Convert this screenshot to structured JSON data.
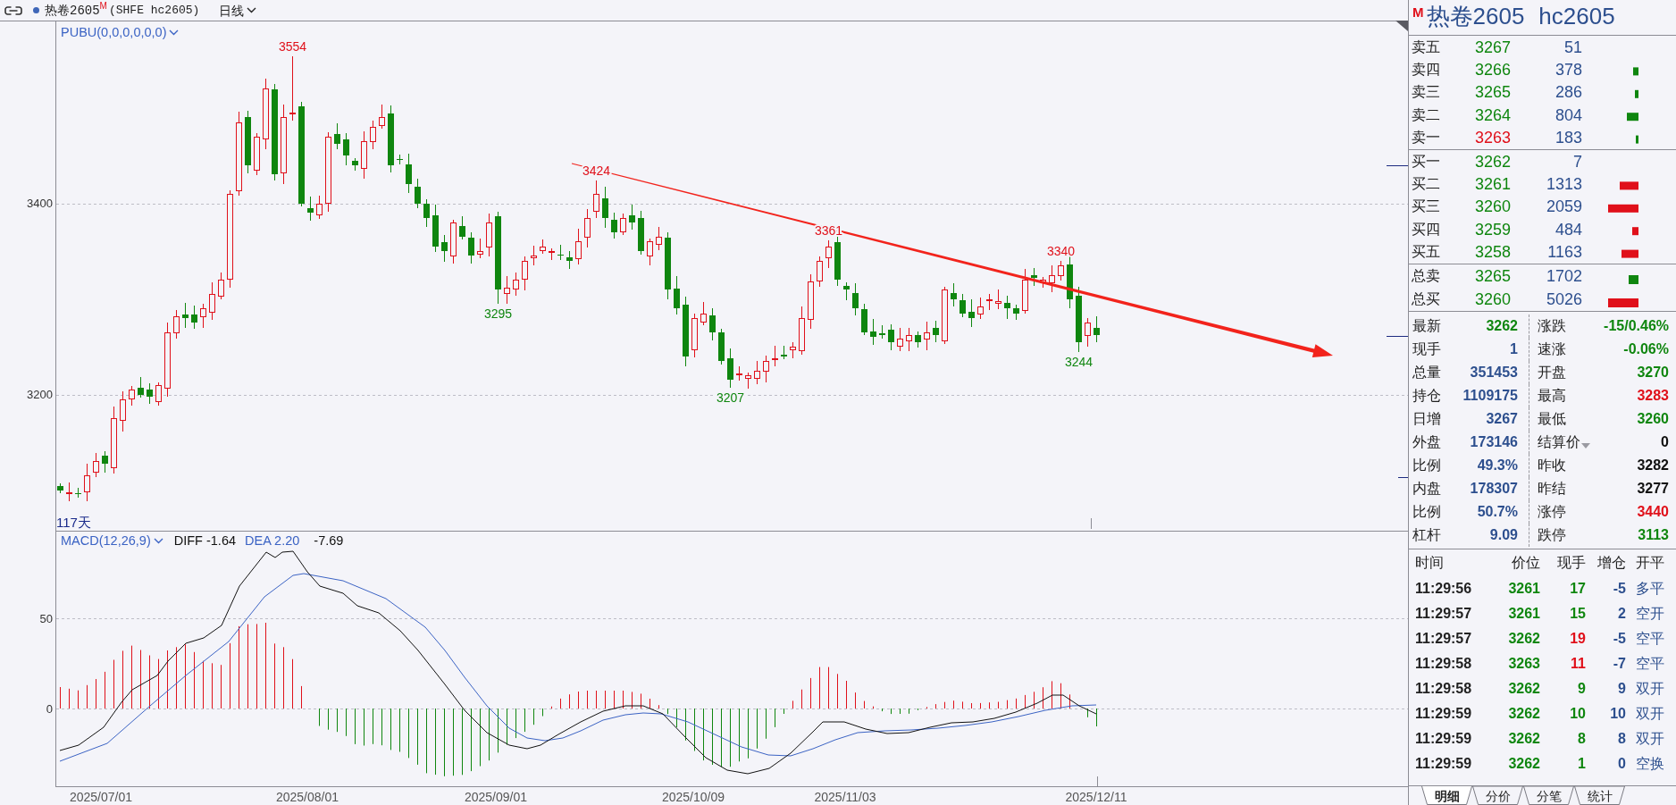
{
  "header": {
    "symbol": "热卷2605",
    "flag": "M",
    "code": "(SHFE hc2605)",
    "period": "日线"
  },
  "price_chart": {
    "indicator": "PUBU(0,0,0,0,0,0)",
    "yticks": [
      "3400",
      "3200"
    ],
    "annotations": [
      {
        "text": "3554",
        "kind": "high"
      },
      {
        "text": "3295",
        "kind": "low"
      },
      {
        "text": "3424",
        "kind": "high"
      },
      {
        "text": "3207",
        "kind": "low"
      },
      {
        "text": "3361",
        "kind": "high"
      },
      {
        "text": "3340",
        "kind": "high"
      },
      {
        "text": "3244",
        "kind": "low"
      }
    ],
    "bar_count": "117天"
  },
  "macd_chart": {
    "indicator": "MACD(12,26,9)",
    "readouts": [
      {
        "text": "DIFF -1.64",
        "color": "#111111"
      },
      {
        "text": "DEA 2.20",
        "color": "#3b63c4"
      },
      {
        "text": "-7.69",
        "color": "#111111"
      }
    ],
    "yticks": [
      "50",
      "0"
    ]
  },
  "x_axis": {
    "labels": [
      "2025/07/01",
      "2025/08/01",
      "2025/09/01",
      "2025/10/09",
      "2025/11/03",
      "2025/12/11"
    ]
  },
  "quote_panel": {
    "flag": "M",
    "name": "热卷2605",
    "code": "hc2605",
    "asks": [
      {
        "label": "卖五",
        "price": "3267",
        "volume": "51",
        "color": "#0f860f"
      },
      {
        "label": "卖四",
        "price": "3266",
        "volume": "378",
        "color": "#0f860f"
      },
      {
        "label": "卖三",
        "price": "3265",
        "volume": "286",
        "color": "#0f860f"
      },
      {
        "label": "卖二",
        "price": "3264",
        "volume": "804",
        "color": "#0f860f"
      },
      {
        "label": "卖一",
        "price": "3263",
        "volume": "183",
        "color": "#e0101a"
      }
    ],
    "bids": [
      {
        "label": "买一",
        "price": "3262",
        "volume": "7",
        "color": "#0f860f"
      },
      {
        "label": "买二",
        "price": "3261",
        "volume": "1313",
        "color": "#0f860f"
      },
      {
        "label": "买三",
        "price": "3260",
        "volume": "2059",
        "color": "#0f860f"
      },
      {
        "label": "买四",
        "price": "3259",
        "volume": "484",
        "color": "#0f860f"
      },
      {
        "label": "买五",
        "price": "3258",
        "volume": "1163",
        "color": "#0f860f"
      }
    ],
    "totals": [
      {
        "label": "总卖",
        "price": "3265",
        "volume": "1702"
      },
      {
        "label": "总买",
        "price": "3260",
        "volume": "5026"
      }
    ],
    "stats": [
      {
        "label": "最新",
        "value": "3262",
        "color": "#0f860f",
        "dropdown": false
      },
      {
        "label": "涨跌",
        "value": "-15/0.46%",
        "color": "#0f860f",
        "dropdown": false
      },
      {
        "label": "现手",
        "value": "1",
        "color": "#2d4f8e",
        "dropdown": false
      },
      {
        "label": "速涨",
        "value": "-0.06%",
        "color": "#0f860f",
        "dropdown": false
      },
      {
        "label": "总量",
        "value": "351453",
        "color": "#2d4f8e",
        "dropdown": false
      },
      {
        "label": "开盘",
        "value": "3270",
        "color": "#0f860f",
        "dropdown": false
      },
      {
        "label": "持仓",
        "value": "1109175",
        "color": "#2d4f8e",
        "dropdown": false
      },
      {
        "label": "最高",
        "value": "3283",
        "color": "#e0101a",
        "dropdown": false
      },
      {
        "label": "日增",
        "value": "3267",
        "color": "#2d4f8e",
        "dropdown": false
      },
      {
        "label": "最低",
        "value": "3260",
        "color": "#0f860f",
        "dropdown": false
      },
      {
        "label": "外盘",
        "value": "173146",
        "color": "#2d4f8e",
        "dropdown": false
      },
      {
        "label": "结算价",
        "value": "0",
        "color": "#111111",
        "dropdown": true
      },
      {
        "label": "比例",
        "value": "49.3%",
        "color": "#2d4f8e",
        "dropdown": false
      },
      {
        "label": "昨收",
        "value": "3282",
        "color": "#111111",
        "dropdown": false
      },
      {
        "label": "内盘",
        "value": "178307",
        "color": "#2d4f8e",
        "dropdown": false
      },
      {
        "label": "昨结",
        "value": "3277",
        "color": "#111111",
        "dropdown": false
      },
      {
        "label": "比例",
        "value": "50.7%",
        "color": "#2d4f8e",
        "dropdown": false
      },
      {
        "label": "涨停",
        "value": "3440",
        "color": "#e0101a",
        "dropdown": false
      },
      {
        "label": "杠杆",
        "value": "9.09",
        "color": "#2d4f8e",
        "dropdown": false
      },
      {
        "label": "跌停",
        "value": "3113",
        "color": "#0f860f",
        "dropdown": false
      }
    ],
    "trades": {
      "columns": [
        "时间",
        "价位",
        "现手",
        "增仓",
        "开平"
      ],
      "rows": [
        {
          "time": "11:29:56",
          "price": "3261",
          "volume": "17",
          "color": "#0f860f",
          "oi_change": "-5",
          "type": "多平"
        },
        {
          "time": "11:29:57",
          "price": "3261",
          "volume": "15",
          "color": "#0f860f",
          "oi_change": "2",
          "type": "空开"
        },
        {
          "time": "11:29:57",
          "price": "3262",
          "volume": "19",
          "color": "#e0101a",
          "oi_change": "-5",
          "type": "空平"
        },
        {
          "time": "11:29:58",
          "price": "3263",
          "volume": "11",
          "color": "#e0101a",
          "oi_change": "-7",
          "type": "空平"
        },
        {
          "time": "11:29:58",
          "price": "3262",
          "volume": "9",
          "color": "#0f860f",
          "oi_change": "9",
          "type": "双开"
        },
        {
          "time": "11:29:59",
          "price": "3262",
          "volume": "10",
          "color": "#0f860f",
          "oi_change": "10",
          "type": "双开"
        },
        {
          "time": "11:29:59",
          "price": "3262",
          "volume": "8",
          "color": "#0f860f",
          "oi_change": "8",
          "type": "双开"
        },
        {
          "time": "11:29:59",
          "price": "3262",
          "volume": "1",
          "color": "#0f860f",
          "oi_change": "0",
          "type": "空换"
        }
      ]
    },
    "tabs": [
      {
        "label": "明细",
        "selected": true
      },
      {
        "label": "分价",
        "selected": false
      },
      {
        "label": "分笔",
        "selected": false
      },
      {
        "label": "统计",
        "selected": false
      }
    ]
  }
}
